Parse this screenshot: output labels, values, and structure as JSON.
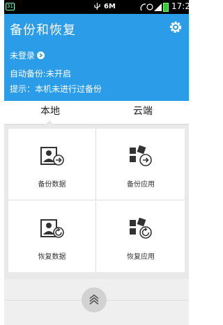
{
  "status_bar": {
    "badge": "31",
    "network_speed": "6M",
    "time": "17:27"
  },
  "header": {
    "title": "备份和恢复",
    "login_text": "未登录",
    "auto_backup": "自动备份:未开启",
    "tip": "提示：本机未进行过备份"
  },
  "tabs": [
    {
      "label": "本地"
    },
    {
      "label": "云端"
    }
  ],
  "actions": [
    {
      "label": "备份数据",
      "icon": "backup-data-icon"
    },
    {
      "label": "备份应用",
      "icon": "backup-apps-icon"
    },
    {
      "label": "恢复数据",
      "icon": "restore-data-icon"
    },
    {
      "label": "恢复应用",
      "icon": "restore-apps-icon"
    }
  ],
  "colors": {
    "header_blue": "#2a9ce8",
    "status_black": "#000000",
    "grid_bg": "#e9e9e9"
  }
}
